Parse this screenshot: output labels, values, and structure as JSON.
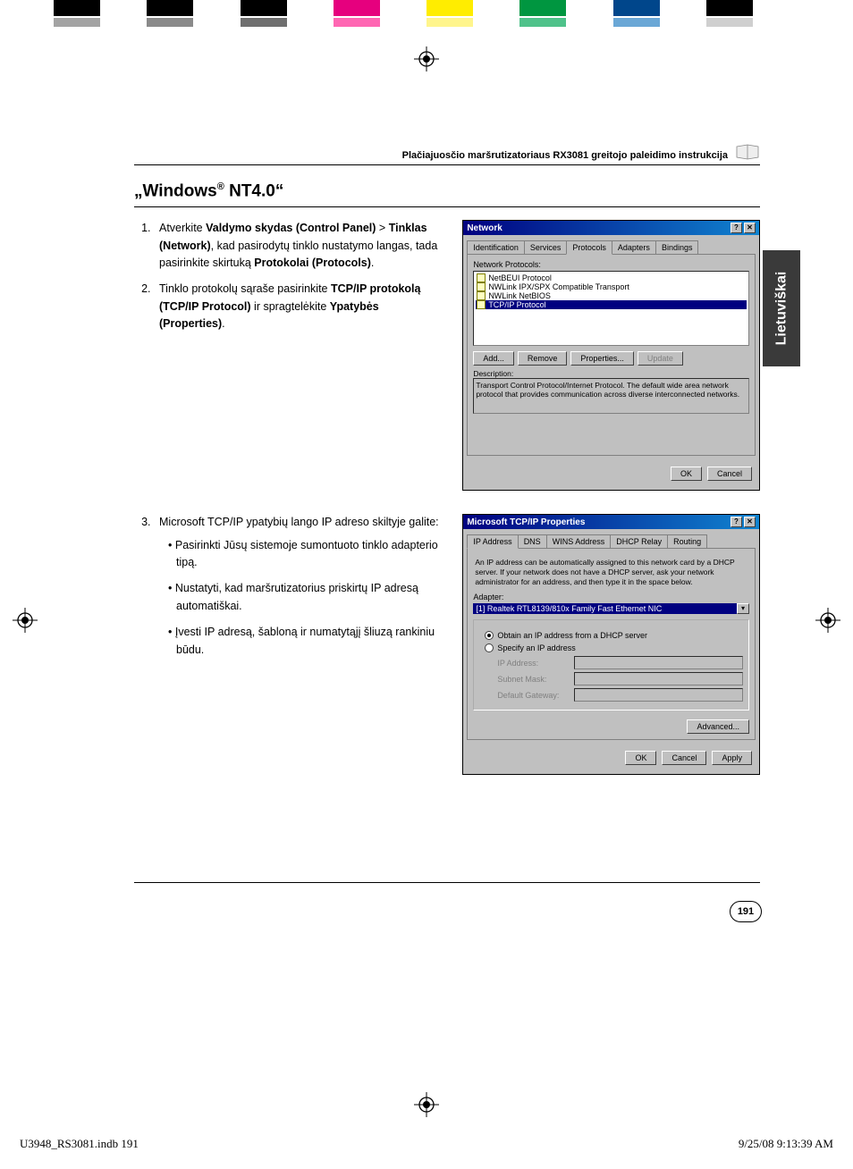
{
  "colorbars": {
    "row1": [
      "#000000",
      "#ffffff",
      "#000000",
      "#ffffff",
      "#000000",
      "#ffffff",
      "#e6007e",
      "#ffffff",
      "#ffed00",
      "#ffffff",
      "#009640",
      "#ffffff",
      "#00468b",
      "#ffffff",
      "#000000",
      "#ffffff"
    ],
    "row2": [
      "#a3a3a3",
      "#ffffff",
      "#8a8a8a",
      "#ffffff",
      "#6f6f6f",
      "#ffffff",
      "#ff66b3",
      "#ffffff",
      "#fff58c",
      "#ffffff",
      "#4fc28a",
      "#ffffff",
      "#6aa7d6",
      "#ffffff",
      "#cfcfcf",
      "#ffffff"
    ]
  },
  "header": {
    "running": "Plačiajuosčio maršrutizatoriaus RX3081 greitojo paleidimo instrukcija"
  },
  "sideTab": "Lietuviškai",
  "section": {
    "title_quote_open": "„",
    "title_main": "Windows",
    "title_reg": "®",
    "title_rest": " NT4.0“"
  },
  "steps": [
    {
      "num": "1.",
      "pre": "Atverkite ",
      "b1": "Valdymo skydas (Control Panel)",
      "mid1": " > ",
      "b2": "Tinklas (Network)",
      "mid2": ", kad pasirodytų tinklo nustatymo langas, tada pasirinkite skirtuką ",
      "b3": "Protokolai (Protocols)",
      "post": "."
    },
    {
      "num": "2.",
      "pre": "Tinklo protokolų sąraše pasirinkite ",
      "b1": "TCP/IP protokolą (TCP/IP Protocol)",
      "mid1": " ir spragtelėkite ",
      "b2": "Ypatybės (Properties)",
      "post": "."
    }
  ],
  "step3": {
    "lead": "Microsoft TCP/IP ypatybių lango IP adreso skiltyje galite:",
    "bullets": [
      "Pasirinkti Jūsų sistemoje sumontuoto tinklo adapterio tipą.",
      "Nustatyti, kad maršrutizatorius priskirtų IP adresą automatiškai.",
      "Įvesti IP adresą, šabloną ir numatytąjį šliuzą rankiniu būdu."
    ]
  },
  "dlg1": {
    "title": "Network",
    "tabs": [
      "Identification",
      "Services",
      "Protocols",
      "Adapters",
      "Bindings"
    ],
    "activeTab": 2,
    "listLabel": "Network Protocols:",
    "items": [
      {
        "text": "NetBEUI Protocol",
        "sel": false
      },
      {
        "text": "NWLink IPX/SPX Compatible Transport",
        "sel": false
      },
      {
        "text": "NWLink NetBIOS",
        "sel": false
      },
      {
        "text": "TCP/IP Protocol",
        "sel": true
      }
    ],
    "btns": {
      "add": "Add...",
      "remove": "Remove",
      "props": "Properties...",
      "update": "Update"
    },
    "descLabel": "Description:",
    "descText": "Transport Control Protocol/Internet Protocol. The default wide area network protocol that provides communication across diverse interconnected networks.",
    "ok": "OK",
    "cancel": "Cancel"
  },
  "dlg2": {
    "title": "Microsoft TCP/IP Properties",
    "tabs": [
      "IP Address",
      "DNS",
      "WINS Address",
      "DHCP Relay",
      "Routing"
    ],
    "activeTab": 0,
    "info": "An IP address can be automatically assigned to this network card by a DHCP server.  If your network does not have a DHCP server, ask your network administrator for an address, and then type it in the space below.",
    "adapterLabel": "Adapter:",
    "adapterSel": "[1] Realtek RTL8139/810x Family Fast Ethernet NIC",
    "radio1": "Obtain an IP address from a DHCP server",
    "radio2": "Specify an IP address",
    "ipLabel": "IP Address:",
    "maskLabel": "Subnet Mask:",
    "gwLabel": "Default Gateway:",
    "adv": "Advanced...",
    "ok": "OK",
    "cancel": "Cancel",
    "apply": "Apply"
  },
  "pageNumber": "191",
  "slug": {
    "file": "U3948_RS3081.indb   191",
    "stamp": "9/25/08   9:13:39 AM"
  }
}
